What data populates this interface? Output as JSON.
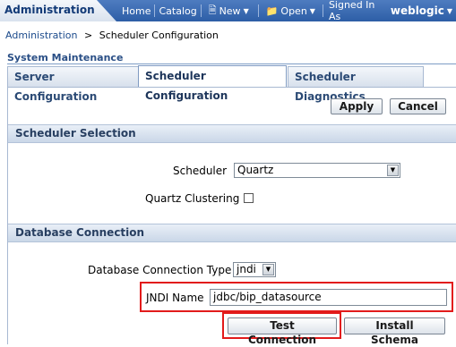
{
  "nav": {
    "admin_tab": "Administration",
    "home": "Home",
    "catalog": "Catalog",
    "new": "New",
    "open": "Open",
    "signed_in_label": "Signed In As",
    "user": "weblogic"
  },
  "breadcrumb": {
    "root": "Administration",
    "separator": ">",
    "current": "Scheduler Configuration"
  },
  "page": {
    "section_title": "System Maintenance"
  },
  "tabs": [
    {
      "label": "Server Configuration",
      "active": false
    },
    {
      "label": "Scheduler Configuration",
      "active": true
    },
    {
      "label": "Scheduler Diagnostics",
      "active": false
    }
  ],
  "actions": {
    "apply": "Apply",
    "cancel": "Cancel"
  },
  "scheduler_selection": {
    "header": "Scheduler Selection",
    "scheduler_label": "Scheduler",
    "scheduler_value": "Quartz",
    "clustering_label": "Quartz Clustering",
    "clustering_checked": false
  },
  "database_connection": {
    "header": "Database Connection",
    "type_label": "Database Connection Type",
    "type_value": "jndi",
    "jndi_label": "JNDI Name",
    "jndi_value": "jdbc/bip_datasource",
    "test_button": "Test Connection",
    "install_button": "Install Schema"
  },
  "colors": {
    "nav_bar": "#2d5ea6",
    "highlight": "#e21b1b",
    "section_header": "#cad7e8"
  }
}
